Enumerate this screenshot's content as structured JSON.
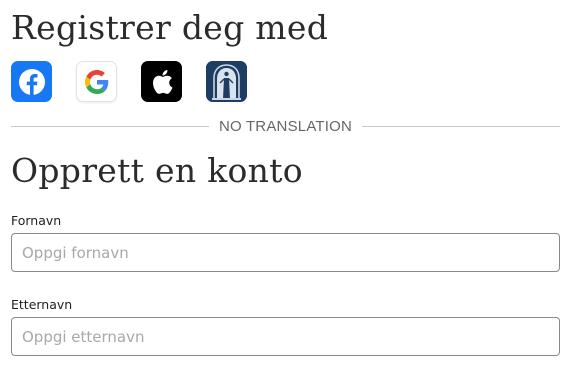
{
  "register_section": {
    "title": "Registrer deg med",
    "providers": [
      {
        "name": "facebook",
        "icon": "facebook-icon",
        "color": "#1877f2"
      },
      {
        "name": "google",
        "icon": "google-icon",
        "color": "#ffffff"
      },
      {
        "name": "apple",
        "icon": "apple-icon",
        "color": "#000000"
      },
      {
        "name": "church-account",
        "icon": "temple-icon",
        "color": "#1e3d63"
      }
    ]
  },
  "divider": {
    "text": "NO TRANSLATION"
  },
  "create_section": {
    "title": "Opprett en konto",
    "first_name": {
      "label": "Fornavn",
      "placeholder": "Oppgi fornavn",
      "value": ""
    },
    "last_name": {
      "label": "Etternavn",
      "placeholder": "Oppgi etternavn",
      "value": ""
    }
  }
}
